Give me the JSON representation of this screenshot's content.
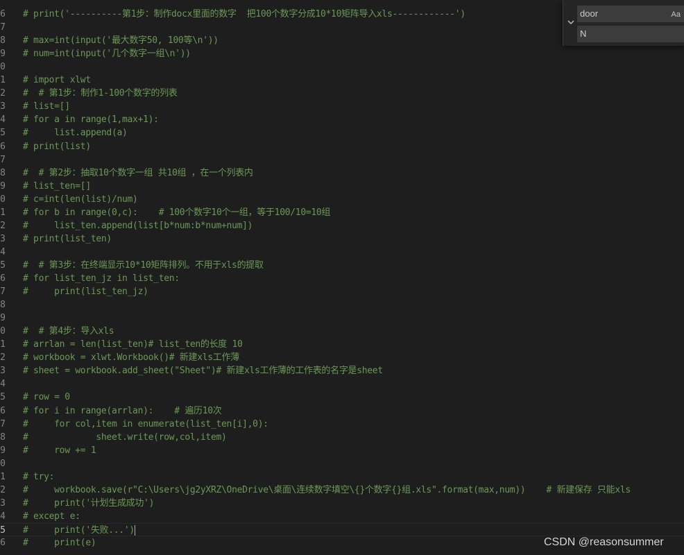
{
  "editor": {
    "lines": [
      {
        "number": "6",
        "text": "# print('----------第1步：制作docx里面的数字  把100个数字分成10*10矩阵导入xls------------')"
      },
      {
        "number": "7",
        "text": ""
      },
      {
        "number": "8",
        "text": "# max=int(input('最大数字50, 100等\\n'))"
      },
      {
        "number": "9",
        "text": "# num=int(input('几个数字一组\\n'))"
      },
      {
        "number": "0",
        "text": ""
      },
      {
        "number": "1",
        "text": "# import xlwt"
      },
      {
        "number": "2",
        "text": "#  # 第1步：制作1-100个数字的列表"
      },
      {
        "number": "3",
        "text": "# list=[]"
      },
      {
        "number": "4",
        "text": "# for a in range(1,max+1):"
      },
      {
        "number": "5",
        "text": "#     list.append(a)"
      },
      {
        "number": "6",
        "text": "# print(list)"
      },
      {
        "number": "7",
        "text": ""
      },
      {
        "number": "8",
        "text": "#  # 第2步：抽取10个数字一组 共10组 ，在一个列表内"
      },
      {
        "number": "9",
        "text": "# list_ten=[]"
      },
      {
        "number": "0",
        "text": "# c=int(len(list)/num)"
      },
      {
        "number": "1",
        "text": "# for b in range(0,c):    # 100个数字10个一组，等于100/10=10组"
      },
      {
        "number": "2",
        "text": "#     list_ten.append(list[b*num:b*num+num])"
      },
      {
        "number": "3",
        "text": "# print(list_ten)"
      },
      {
        "number": "4",
        "text": ""
      },
      {
        "number": "5",
        "text": "#  # 第3步：在终端显示10*10矩阵排列。不用于xls的提取"
      },
      {
        "number": "6",
        "text": "# for list_ten_jz in list_ten:"
      },
      {
        "number": "7",
        "text": "#     print(list_ten_jz)"
      },
      {
        "number": "8",
        "text": ""
      },
      {
        "number": "9",
        "text": ""
      },
      {
        "number": "0",
        "text": "#  # 第4步：导入xls"
      },
      {
        "number": "1",
        "text": "# arrlan = len(list_ten)# list_ten的长度 10"
      },
      {
        "number": "2",
        "text": "# workbook = xlwt.Workbook()# 新建xls工作薄"
      },
      {
        "number": "3",
        "text": "# sheet = workbook.add_sheet(\"Sheet\")# 新建xls工作薄的工作表的名字是sheet"
      },
      {
        "number": "4",
        "text": ""
      },
      {
        "number": "5",
        "text": "# row = 0"
      },
      {
        "number": "6",
        "text": "# for i in range(arrlan):    # 遍历10次"
      },
      {
        "number": "7",
        "text": "#     for col,item in enumerate(list_ten[i],0):"
      },
      {
        "number": "8",
        "text": "#             sheet.write(row,col,item)"
      },
      {
        "number": "9",
        "text": "#     row += 1"
      },
      {
        "number": "0",
        "text": ""
      },
      {
        "number": "1",
        "text": "# try:"
      },
      {
        "number": "2",
        "text": "#     workbook.save(r\"C:\\Users\\jg2yXRZ\\OneDrive\\桌面\\连续数字填空\\{}个数字{}组.xls\".format(max,num))    # 新建保存 只能xls"
      },
      {
        "number": "3",
        "text": "#     print('计划生成成功')"
      },
      {
        "number": "4",
        "text": "# except e:"
      },
      {
        "number": "5",
        "text": "#     print('失败...')"
      },
      {
        "number": "6",
        "text": "#     print(e)"
      }
    ]
  },
  "find_widget": {
    "find_value": "door",
    "replace_value": "N",
    "match_case_label": "Aa",
    "toggle_icon": "chevron-down-icon"
  },
  "watermark": "CSDN @reasonsummer",
  "colors": {
    "background": "#1e1e1e",
    "comment": "#6a9955",
    "line_number": "#858585"
  }
}
